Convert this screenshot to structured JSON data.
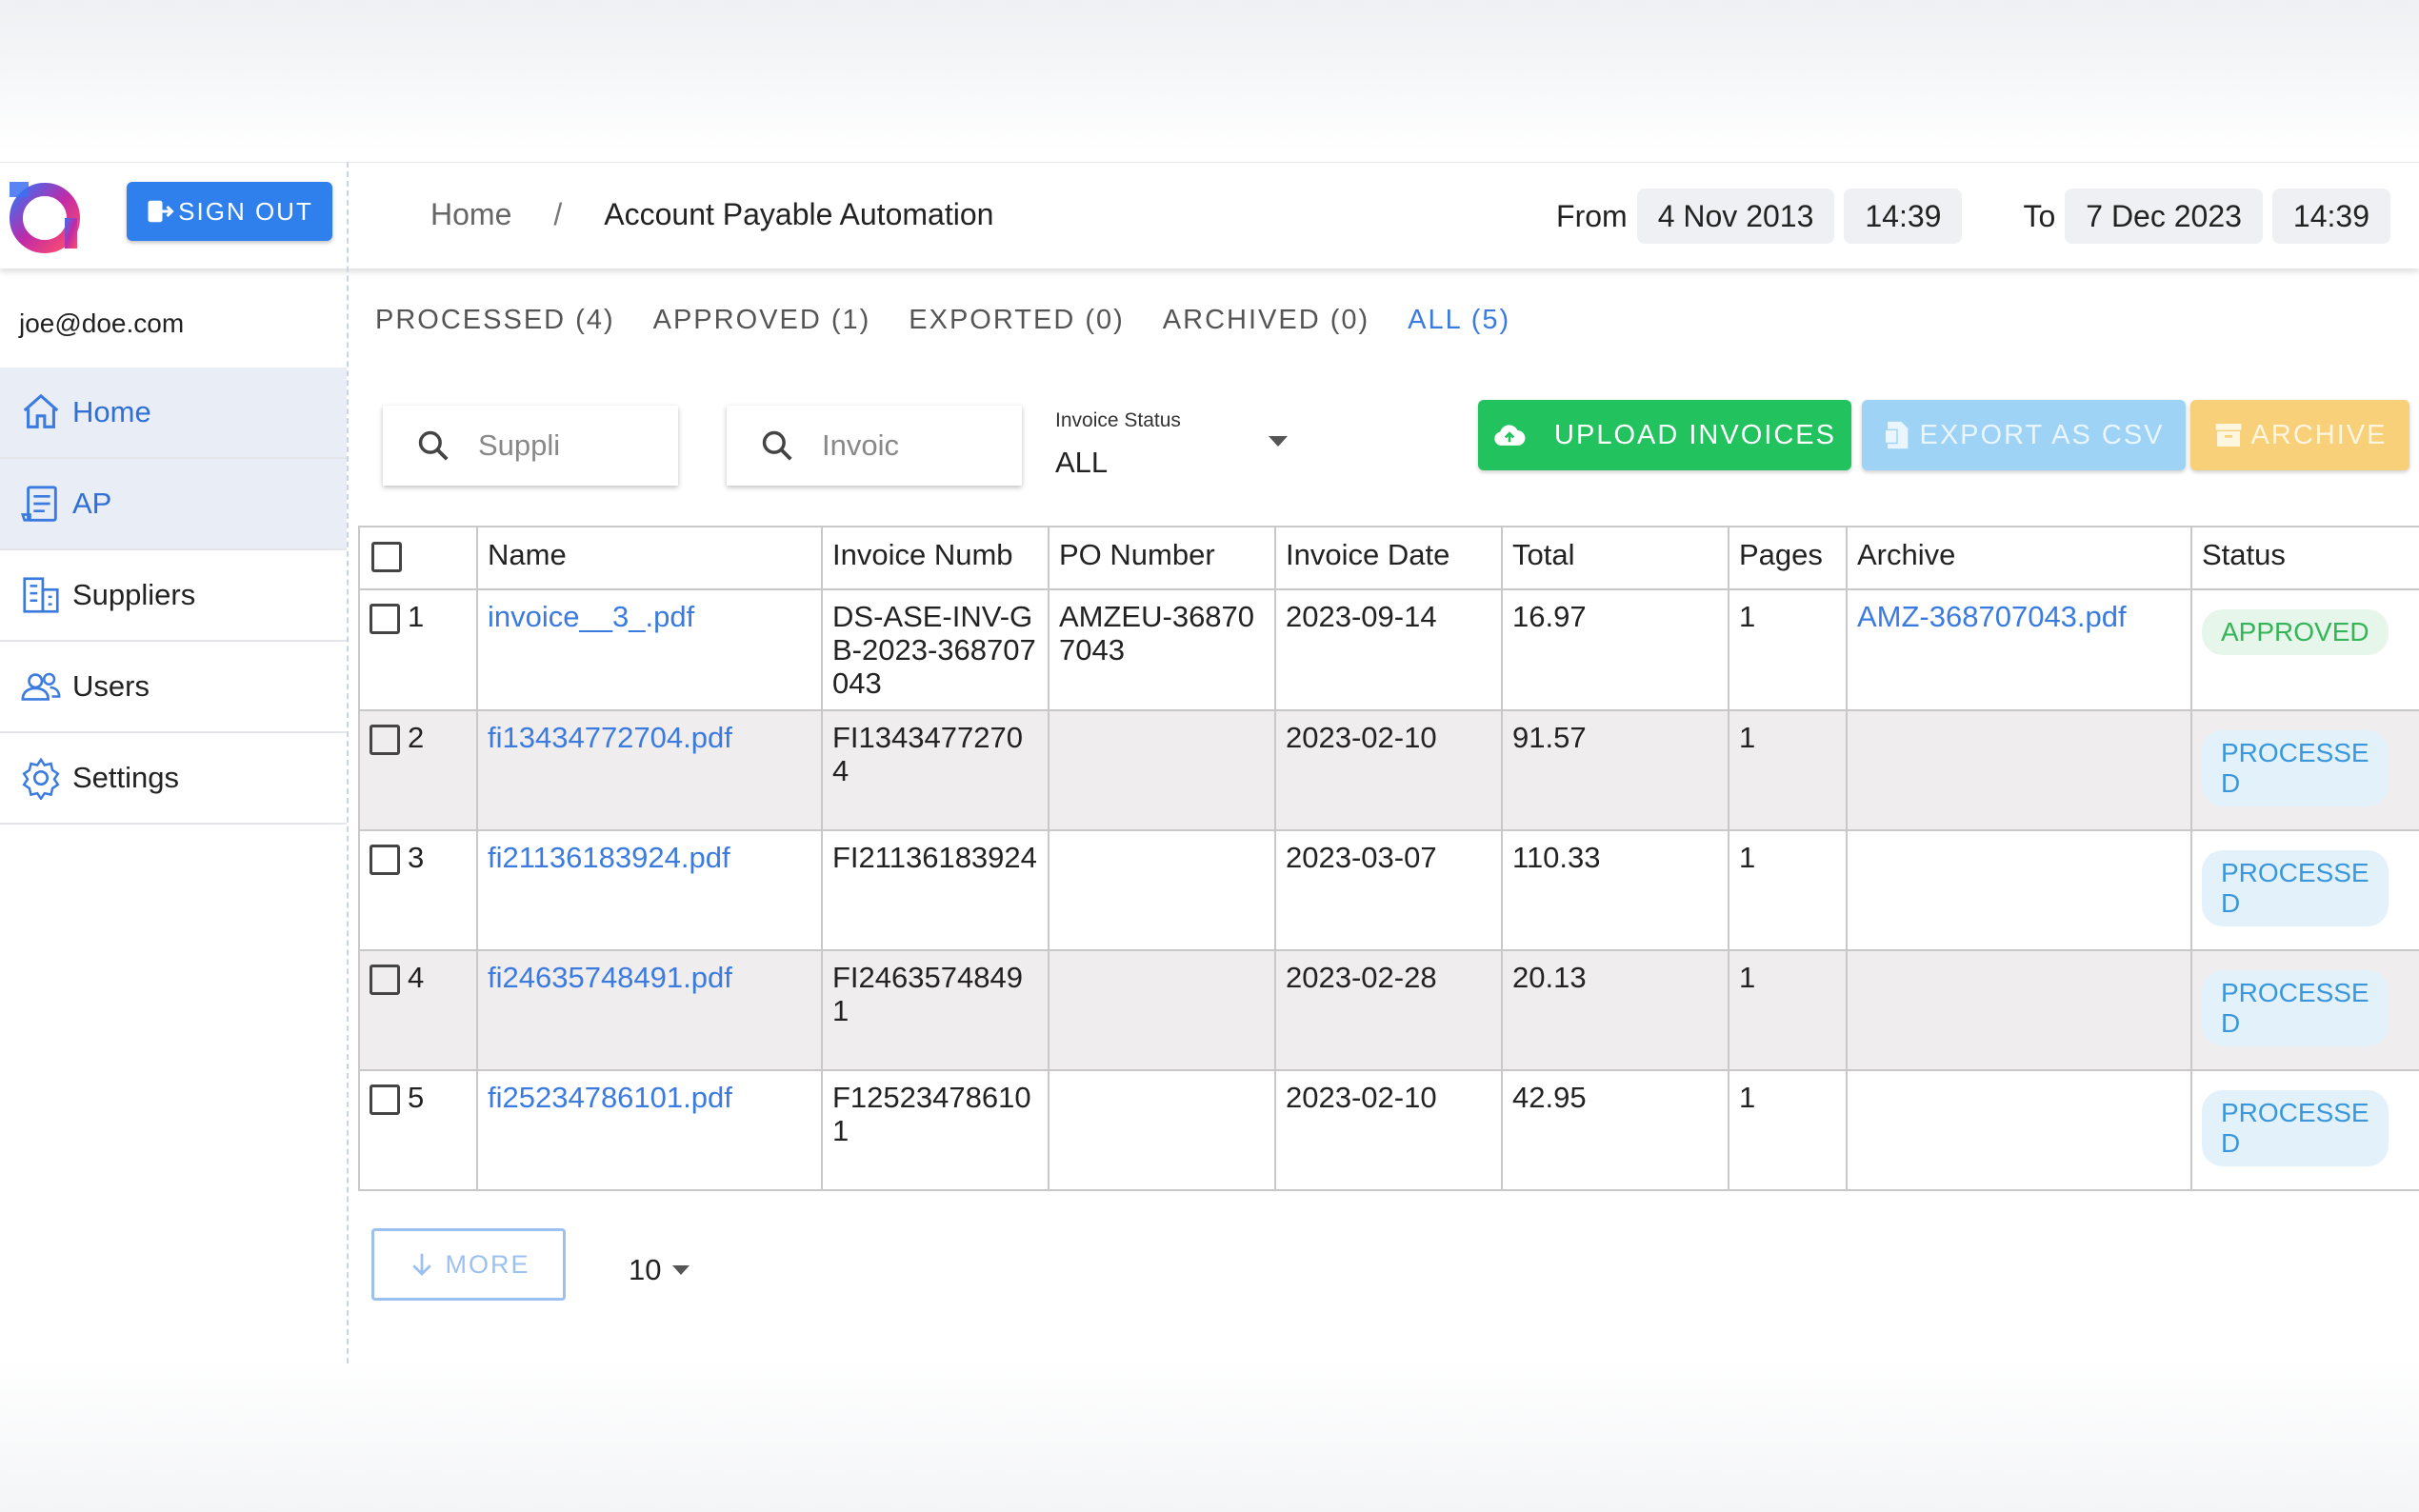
{
  "header": {
    "sign_out_label": "SIGN OUT",
    "breadcrumb": {
      "home": "Home",
      "separator": "/",
      "current": "Account Payable Automation"
    },
    "date_range": {
      "from_label": "From",
      "from_date": "4 Nov 2013",
      "from_time": "14:39",
      "to_label": "To",
      "to_date": "7 Dec 2023",
      "to_time": "14:39"
    }
  },
  "sidebar": {
    "user_email": "joe@doe.com",
    "items": [
      {
        "label": "Home",
        "icon": "home-icon",
        "active": true
      },
      {
        "label": "AP",
        "icon": "invoice-icon",
        "active": true
      },
      {
        "label": "Suppliers",
        "icon": "building-icon",
        "active": false
      },
      {
        "label": "Users",
        "icon": "users-icon",
        "active": false
      },
      {
        "label": "Settings",
        "icon": "gear-icon",
        "active": false
      }
    ]
  },
  "tabs": [
    {
      "label": "PROCESSED (4)",
      "active": false
    },
    {
      "label": "APPROVED (1)",
      "active": false
    },
    {
      "label": "EXPORTED (0)",
      "active": false
    },
    {
      "label": "ARCHIVED (0)",
      "active": false
    },
    {
      "label": "ALL (5)",
      "active": true
    }
  ],
  "filters": {
    "supplier_placeholder": "Suppli",
    "invoice_placeholder": "Invoic",
    "status_label": "Invoice Status",
    "status_value": "ALL"
  },
  "actions": {
    "upload_label": "UPLOAD INVOICES",
    "export_label": "EXPORT AS CSV",
    "archive_label": "ARCHIVE"
  },
  "table": {
    "columns": [
      "Name",
      "Invoice Numb",
      "PO Number",
      "Invoice Date",
      "Total",
      "Pages",
      "Archive",
      "Status"
    ],
    "rows": [
      {
        "index": "1",
        "name": "invoice__3_.pdf",
        "invoice_number": "DS-ASE-INV-GB-2023-368707043",
        "po_number": "AMZEU-368707043",
        "invoice_date": "2023-09-14",
        "total": "16.97",
        "pages": "1",
        "archive": "AMZ-368707043.pdf",
        "status": "APPROVED"
      },
      {
        "index": "2",
        "name": "fi13434772704.pdf",
        "invoice_number": "FI13434772704",
        "po_number": "",
        "invoice_date": "2023-02-10",
        "total": "91.57",
        "pages": "1",
        "archive": "",
        "status": "PROCESSED"
      },
      {
        "index": "3",
        "name": "fi21136183924.pdf",
        "invoice_number": "FI21136183924",
        "po_number": "",
        "invoice_date": "2023-03-07",
        "total": "110.33",
        "pages": "1",
        "archive": "",
        "status": "PROCESSED"
      },
      {
        "index": "4",
        "name": "fi24635748491.pdf",
        "invoice_number": "FI24635748491",
        "po_number": "",
        "invoice_date": "2023-02-28",
        "total": "20.13",
        "pages": "1",
        "archive": "",
        "status": "PROCESSED"
      },
      {
        "index": "5",
        "name": "fi25234786101.pdf",
        "invoice_number": "F125234786101",
        "po_number": "",
        "invoice_date": "2023-02-10",
        "total": "42.95",
        "pages": "1",
        "archive": "",
        "status": "PROCESSED"
      }
    ]
  },
  "footer": {
    "more_label": "MORE",
    "page_size": "10"
  },
  "colors": {
    "primary": "#2f80ed",
    "upload": "#22c35e",
    "export": "#9ed3f5",
    "archive": "#f8d079",
    "link": "#3b7be0"
  }
}
